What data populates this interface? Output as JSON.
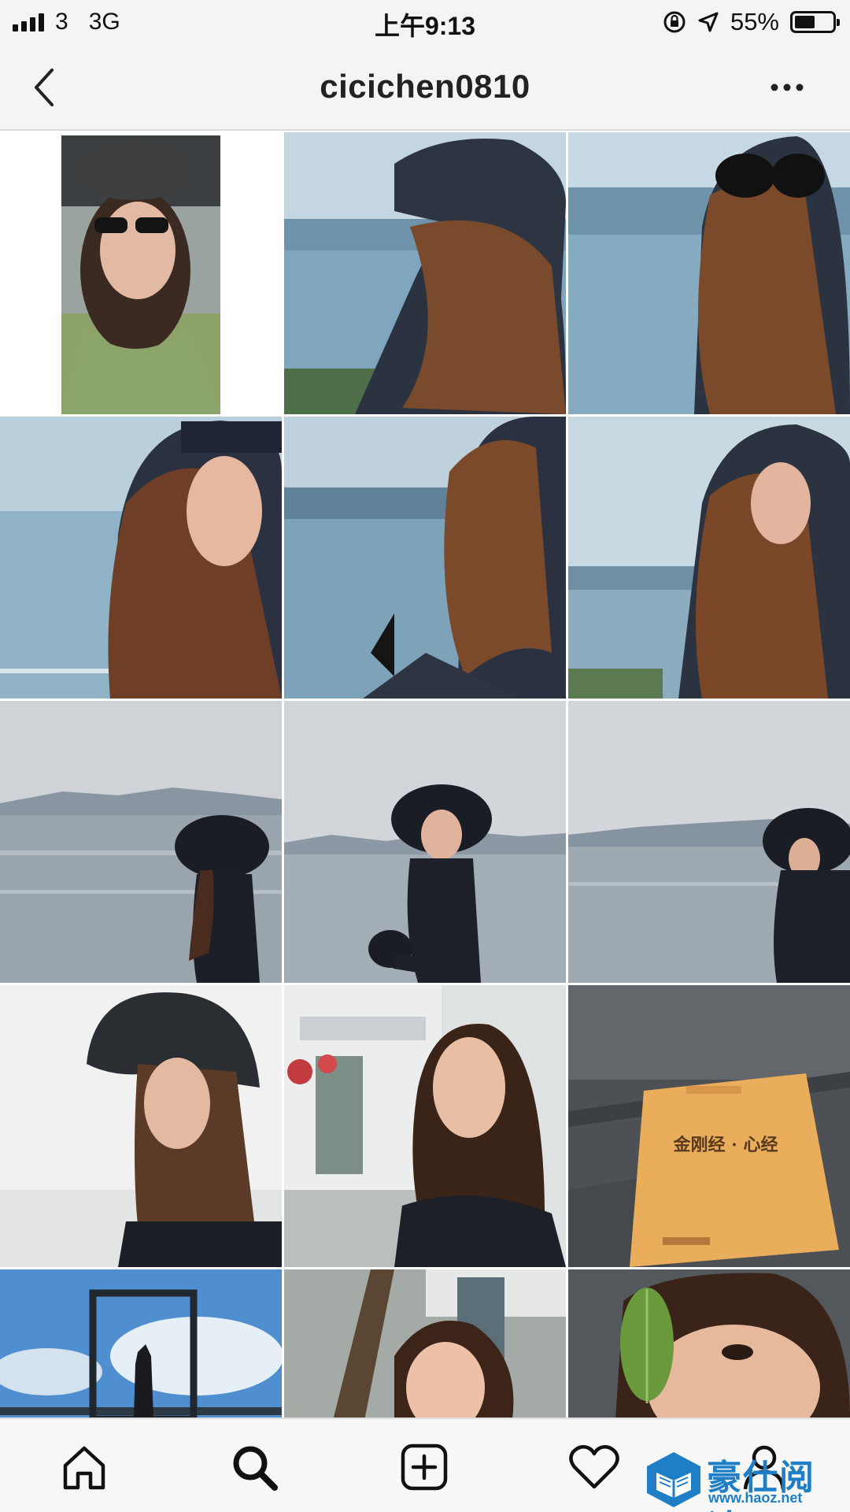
{
  "status_bar": {
    "carrier": "3",
    "network": "3G",
    "time": "上午9:13",
    "battery_percent": "55%",
    "battery_level": 0.55,
    "icons": [
      "signal-icon",
      "rotation-lock-icon",
      "location-arrow-icon",
      "battery-icon"
    ]
  },
  "nav": {
    "title": "cicichen0810",
    "back_icon": "chevron-left-icon",
    "more_icon": "more-dots-icon"
  },
  "grid": {
    "rows": 5,
    "columns": 3,
    "photos": [
      {
        "description": "selfie-sunglasses-cap"
      },
      {
        "description": "hooded-lake"
      },
      {
        "description": "hood-sunglasses-lake"
      },
      {
        "description": "hood-closeup-eyes-closed"
      },
      {
        "description": "hood-holding-sunglasses"
      },
      {
        "description": "hood-closeup-lake"
      },
      {
        "description": "seaside-bucket-hat"
      },
      {
        "description": "seaside-crouching-hat"
      },
      {
        "description": "seaside-hat-right"
      },
      {
        "description": "bucket-hat-portrait"
      },
      {
        "description": "portrait-building"
      },
      {
        "description": "book-on-stone"
      },
      {
        "description": "frame-silhouette"
      },
      {
        "description": "smiling-tree"
      },
      {
        "description": "leaf-over-eye"
      }
    ],
    "book_title": "金刚经 · 心经"
  },
  "tab_bar": {
    "tabs": [
      "home-icon",
      "search-icon",
      "add-post-icon",
      "heart-icon",
      "profile-icon"
    ]
  },
  "watermark": {
    "name": "豪仕阅读",
    "url": "www.haoz.net"
  },
  "colors": {
    "bar_background": "#f4f4f4",
    "watermark_blue": "#1e7fc6"
  }
}
